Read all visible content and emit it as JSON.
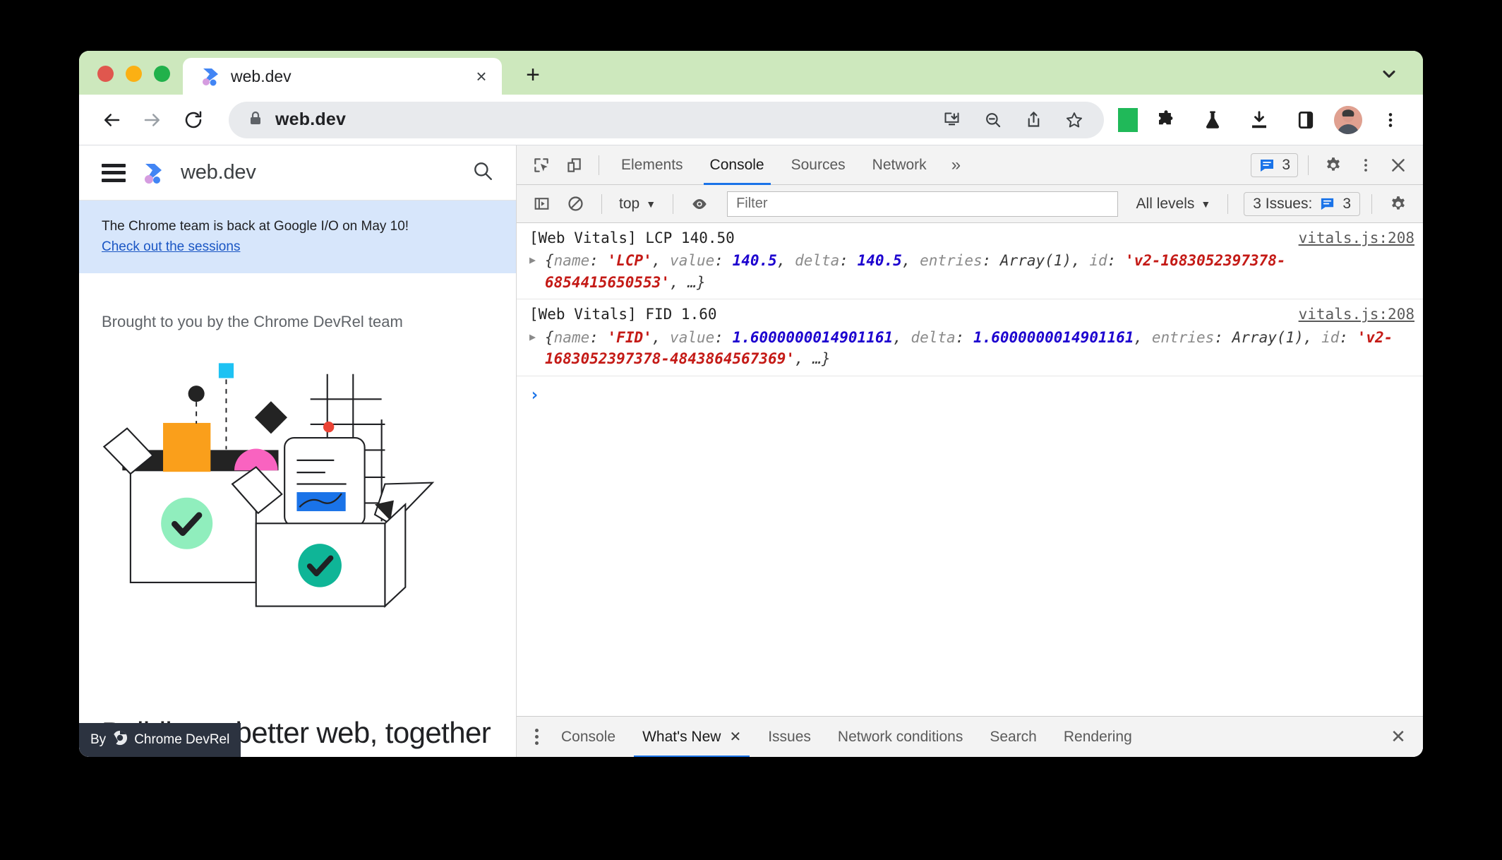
{
  "browser": {
    "tab": {
      "title": "web.dev",
      "close_label": "×"
    },
    "new_tab_label": "+",
    "omnibox": {
      "url": "web.dev",
      "lock_icon": "lock-icon"
    },
    "nav": {
      "back": "back-icon",
      "forward": "forward-icon",
      "reload": "reload-icon"
    },
    "toolbar_icons": [
      "install-icon",
      "zoom-out-icon",
      "share-icon",
      "bookmark-star-icon",
      "green-square-extension-icon",
      "puzzle-extensions-icon",
      "flask-experiments-icon",
      "download-icon",
      "side-panel-icon",
      "avatar",
      "chrome-menu-icon"
    ]
  },
  "page": {
    "site_name": "web.dev",
    "banner_text": "The Chrome team is back at Google I/O on May 10!",
    "banner_link": "Check out the sessions",
    "brought_by": "Brought to you by the Chrome DevRel team",
    "hero_title": "Building a better web, together",
    "byline_prefix": "By",
    "byline_author": "Chrome DevRel"
  },
  "devtools": {
    "tabs": [
      {
        "label": "Elements",
        "active": false
      },
      {
        "label": "Console",
        "active": true
      },
      {
        "label": "Sources",
        "active": false
      },
      {
        "label": "Network",
        "active": false
      }
    ],
    "more_tabs": "»",
    "issue_badge_count": "3",
    "filter": {
      "context": "top",
      "placeholder": "Filter",
      "levels": "All levels",
      "issues_label": "3 Issues:",
      "issues_count": "3"
    },
    "messages": [
      {
        "summary": "[Web Vitals] LCP 140.50",
        "source": "vitals.js:208",
        "parts": [
          {
            "t": "{",
            "c": "plain"
          },
          {
            "t": "name",
            "c": "k"
          },
          {
            "t": ": ",
            "c": "plain"
          },
          {
            "t": "'LCP'",
            "c": "str"
          },
          {
            "t": ", ",
            "c": "plain"
          },
          {
            "t": "value",
            "c": "k"
          },
          {
            "t": ": ",
            "c": "plain"
          },
          {
            "t": "140.5",
            "c": "num"
          },
          {
            "t": ", ",
            "c": "plain"
          },
          {
            "t": "delta",
            "c": "k"
          },
          {
            "t": ": ",
            "c": "plain"
          },
          {
            "t": "140.5",
            "c": "num"
          },
          {
            "t": ", ",
            "c": "plain"
          },
          {
            "t": "entries",
            "c": "k"
          },
          {
            "t": ": ",
            "c": "plain"
          },
          {
            "t": "Array(1)",
            "c": "plain"
          },
          {
            "t": ", ",
            "c": "plain"
          },
          {
            "t": "id",
            "c": "k"
          },
          {
            "t": ": ",
            "c": "plain"
          },
          {
            "t": "'v2-1683052397378-6854415650553'",
            "c": "str"
          },
          {
            "t": ", …}",
            "c": "plain"
          }
        ]
      },
      {
        "summary": "[Web Vitals] FID 1.60",
        "source": "vitals.js:208",
        "parts": [
          {
            "t": "{",
            "c": "plain"
          },
          {
            "t": "name",
            "c": "k"
          },
          {
            "t": ": ",
            "c": "plain"
          },
          {
            "t": "'FID'",
            "c": "str"
          },
          {
            "t": ", ",
            "c": "plain"
          },
          {
            "t": "value",
            "c": "k"
          },
          {
            "t": ": ",
            "c": "plain"
          },
          {
            "t": "1.6000000014901161",
            "c": "num"
          },
          {
            "t": ", ",
            "c": "plain"
          },
          {
            "t": "delta",
            "c": "k"
          },
          {
            "t": ": ",
            "c": "plain"
          },
          {
            "t": "1.6000000014901161",
            "c": "num"
          },
          {
            "t": ", ",
            "c": "plain"
          },
          {
            "t": "entries",
            "c": "k"
          },
          {
            "t": ": ",
            "c": "plain"
          },
          {
            "t": "Array(1)",
            "c": "plain"
          },
          {
            "t": ", ",
            "c": "plain"
          },
          {
            "t": "id",
            "c": "k"
          },
          {
            "t": ": ",
            "c": "plain"
          },
          {
            "t": "'v2-1683052397378-4843864567369'",
            "c": "str"
          },
          {
            "t": ", …}",
            "c": "plain"
          }
        ]
      }
    ],
    "prompt_symbol": "›",
    "drawer_tabs": [
      {
        "label": "Console",
        "active": false,
        "closable": false
      },
      {
        "label": "What's New",
        "active": true,
        "closable": true
      },
      {
        "label": "Issues",
        "active": false,
        "closable": false
      },
      {
        "label": "Network conditions",
        "active": false,
        "closable": false
      },
      {
        "label": "Search",
        "active": false,
        "closable": false
      },
      {
        "label": "Rendering",
        "active": false,
        "closable": false
      }
    ],
    "close_label": "✕"
  },
  "colors": {
    "tabstrip_green": "#cde8bd",
    "accent_blue": "#1a73e8",
    "banner_blue": "#d7e6fb",
    "string_red": "#c41a16",
    "number_blue": "#1c00cf"
  }
}
